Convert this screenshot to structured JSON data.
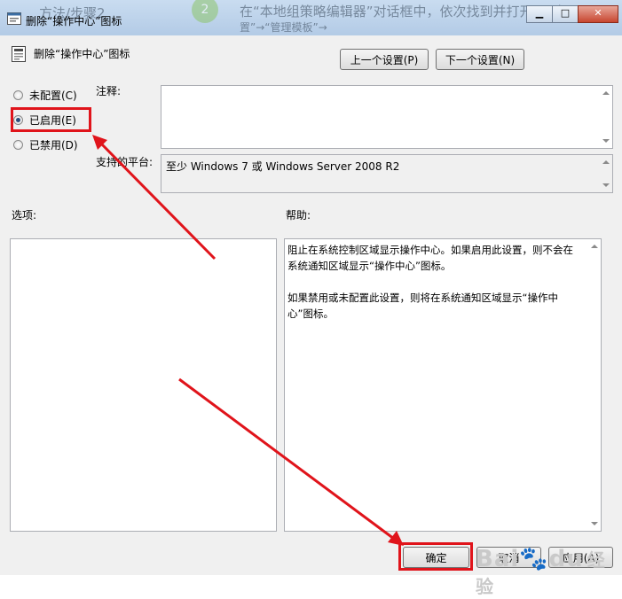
{
  "background": {
    "left_text": "方法/步骤2",
    "step_badge": "2",
    "right_text": "在“本地组策略编辑器”对话框中，依次找到并打开“用户配",
    "right_text_line2": "置”→“管理模板”→"
  },
  "window": {
    "title": "删除“操作中心”图标",
    "buttons": {
      "minimize": "▁",
      "maximize": "□",
      "close": "✕"
    }
  },
  "header": {
    "policy_name": "删除“操作中心”图标",
    "prev_label": "上一个设置(P)",
    "next_label": "下一个设置(N)"
  },
  "state": {
    "options": [
      {
        "label": "未配置(C)",
        "selected": false
      },
      {
        "label": "已启用(E)",
        "selected": true
      },
      {
        "label": "已禁用(D)",
        "selected": false
      }
    ]
  },
  "comment": {
    "label": "注释:",
    "value": ""
  },
  "platform": {
    "label": "支持的平台:",
    "value": "至少 Windows 7 或 Windows Server 2008 R2"
  },
  "options_pane": {
    "label": "选项:"
  },
  "help_pane": {
    "label": "帮助:",
    "paragraphs": [
      " 阻止在系统控制区域显示操作中心。如果启用此设置，则不会在系统通知区域显示“操作中心”图标。",
      "如果禁用或未配置此设置，则将在系统通知区域显示“操作中心”图标。"
    ]
  },
  "footer": {
    "ok_label": "确定",
    "cancel_label": "取消",
    "apply_label": "应用(A)"
  },
  "annotations": {
    "color": "#e0141b"
  },
  "watermark": {
    "text": "Bai",
    "paw": "🐾",
    "suffix": "du",
    "jingyan": "经验"
  }
}
